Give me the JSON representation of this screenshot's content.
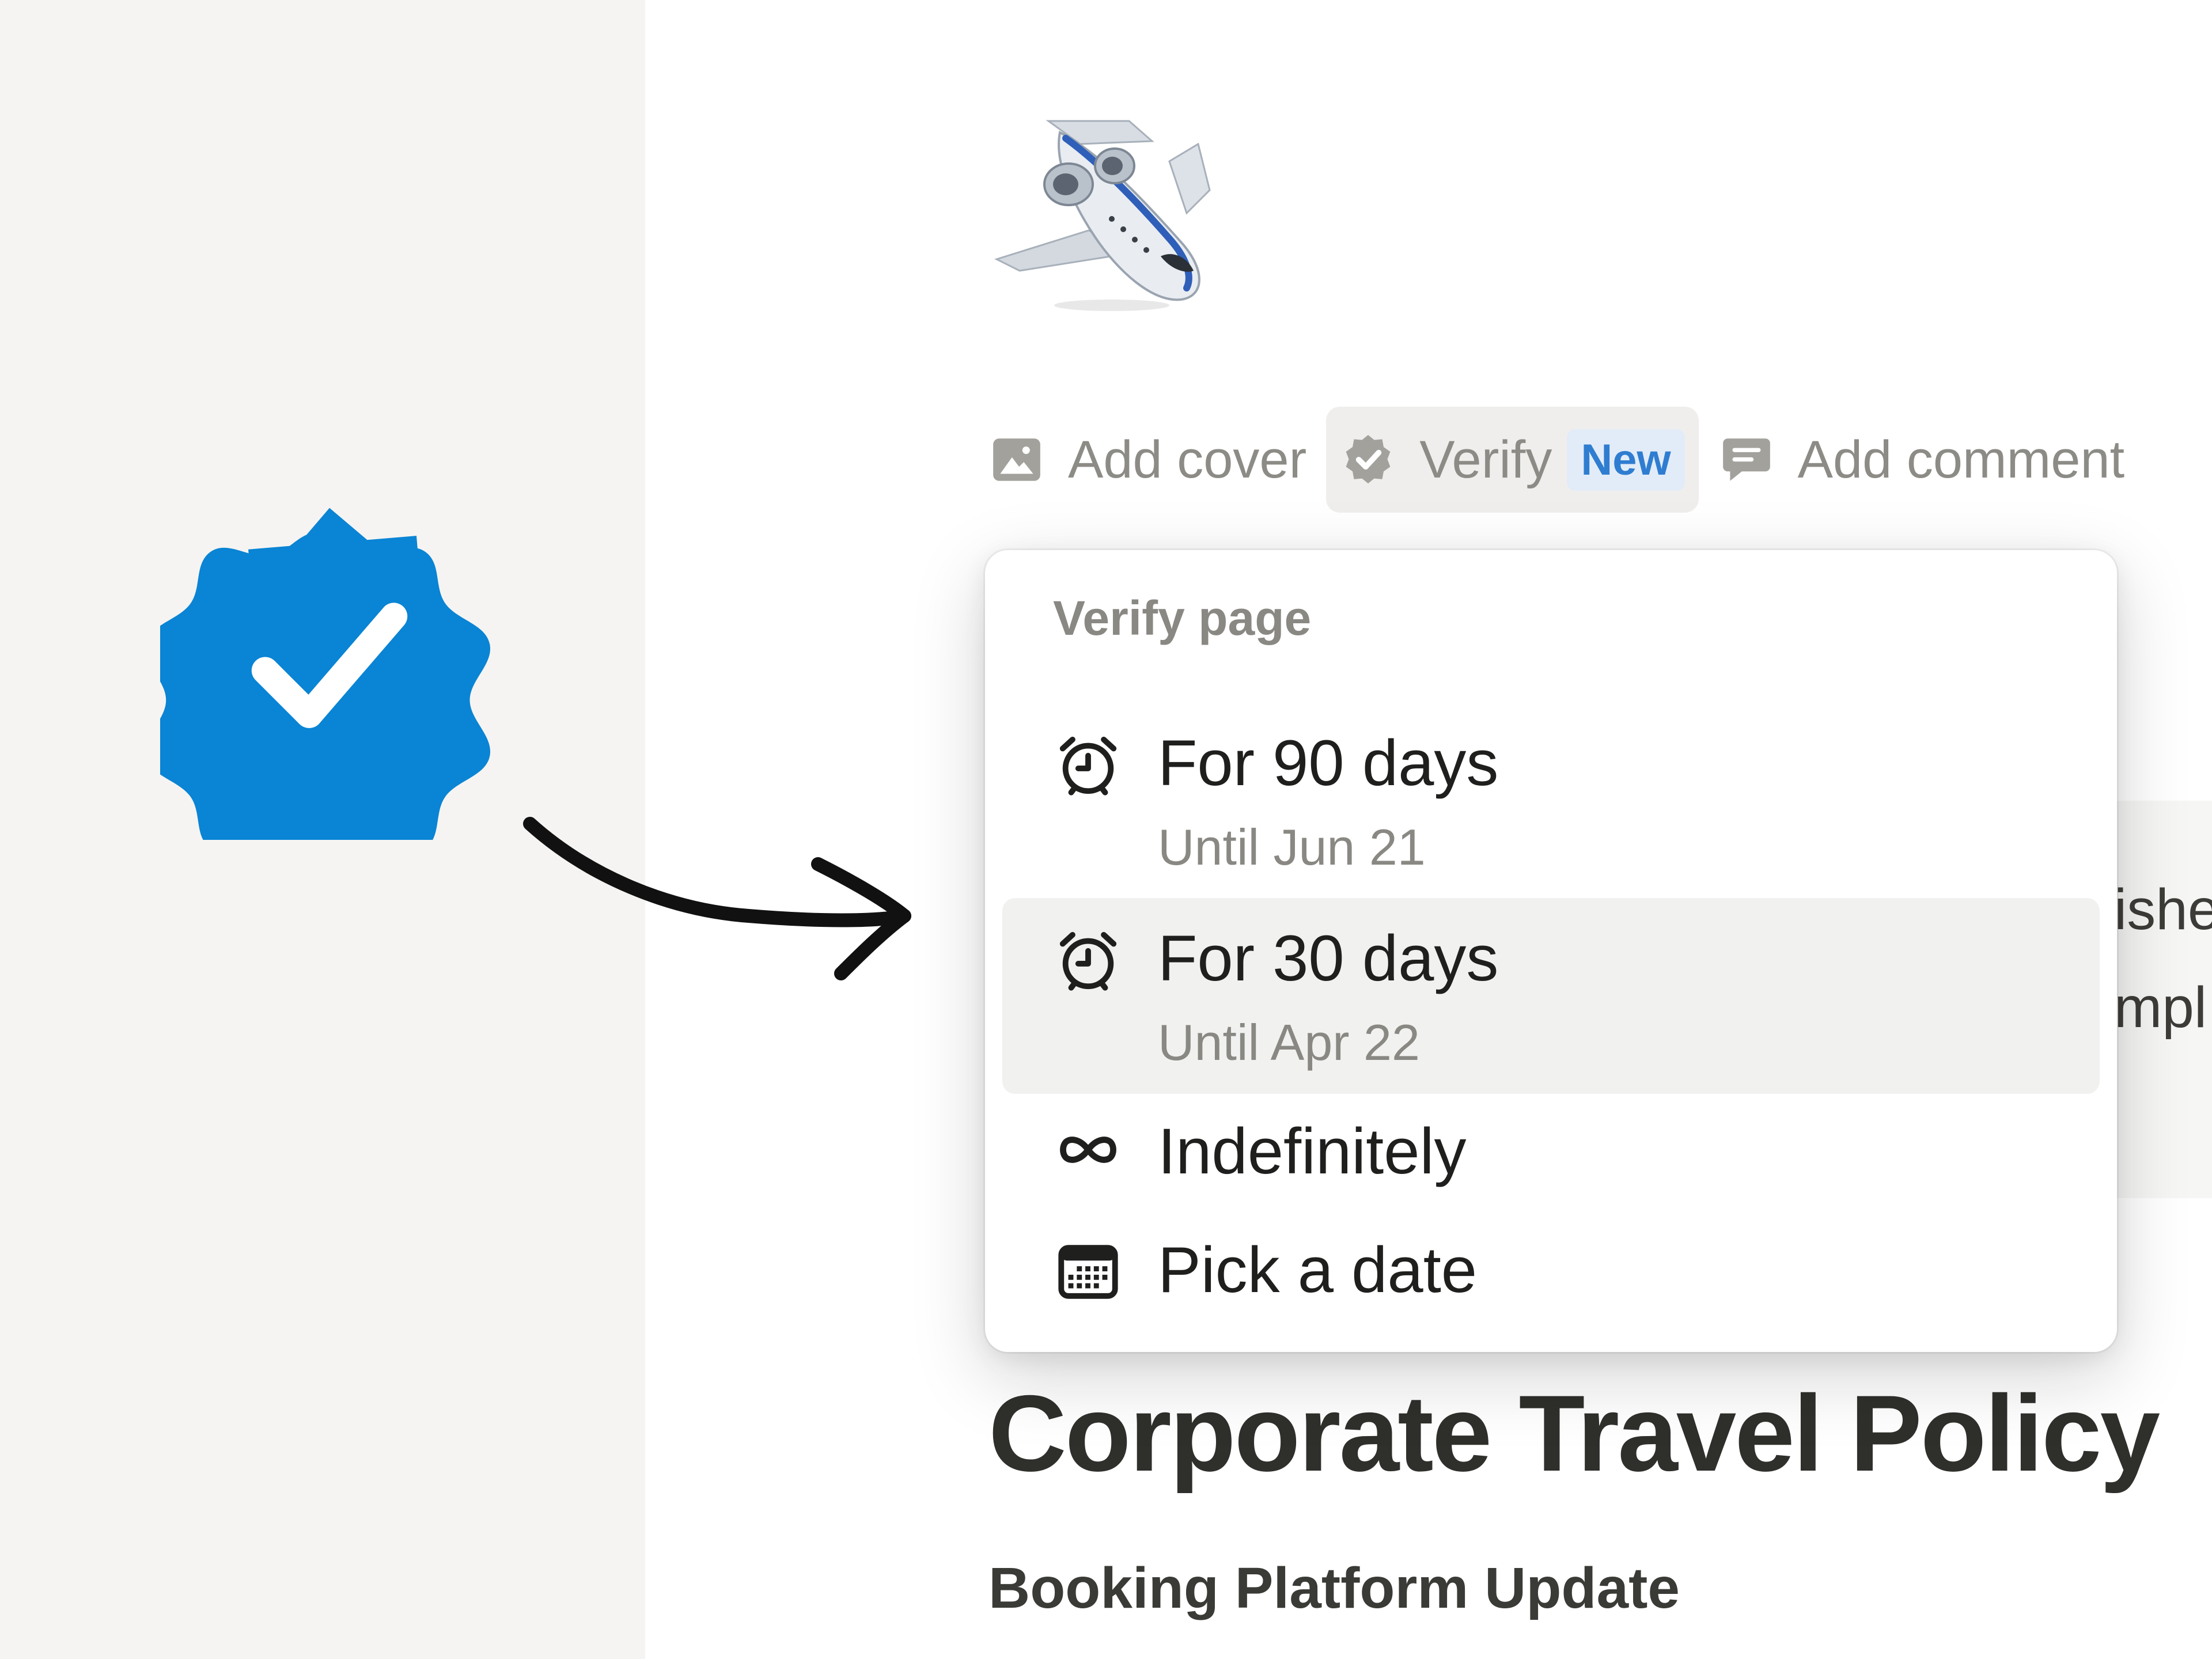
{
  "toolbar": {
    "add_cover": "Add cover",
    "verify": "Verify",
    "verify_badge": "New",
    "add_comment": "Add comment"
  },
  "verify_menu": {
    "header": "Verify page",
    "items": [
      {
        "label": "For 90 days",
        "sublabel": "Until Jun 21",
        "icon": "alarm-clock-icon"
      },
      {
        "label": "For 30 days",
        "sublabel": "Until Apr 22",
        "icon": "alarm-clock-icon",
        "highlighted": true
      },
      {
        "label": "Indefinitely",
        "icon": "infinity-icon"
      },
      {
        "label": "Pick a date",
        "icon": "calendar-icon"
      }
    ]
  },
  "page": {
    "title": "Corporate Travel Policy",
    "section_heading": "Booking Platform Update",
    "icon": "airplane-icon",
    "snippet_line_1": "ishe",
    "snippet_line_2": "mpl"
  },
  "decoration": {
    "badge_icon": "verified-badge-icon",
    "badge_color": "#0a84d4",
    "arrow_icon": "hand-drawn-arrow-icon"
  }
}
